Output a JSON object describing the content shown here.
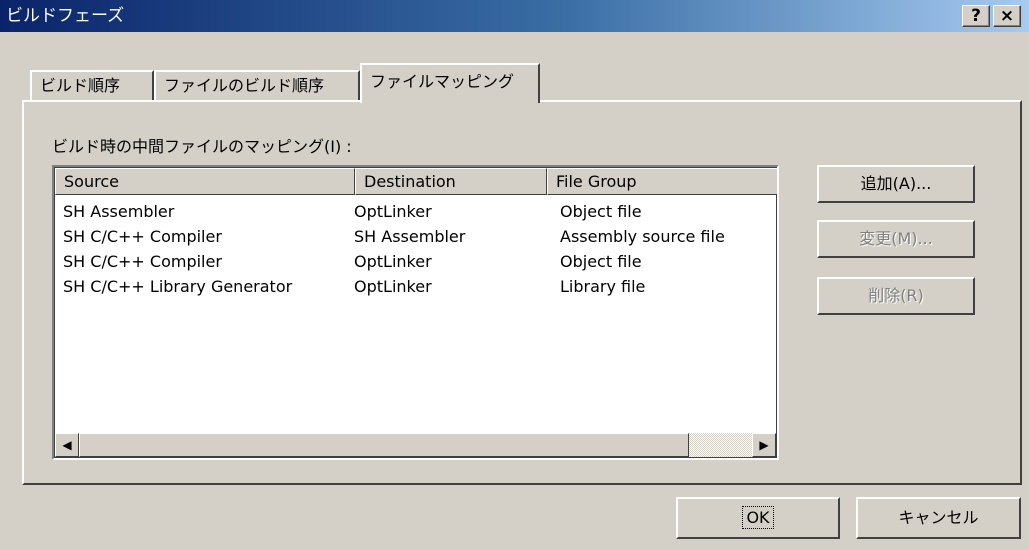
{
  "window": {
    "title": "ビルドフェーズ",
    "help_label": "?",
    "close_label": "×"
  },
  "tabs": [
    {
      "label": "ビルド順序",
      "active": false
    },
    {
      "label": "ファイルのビルド順序",
      "active": false
    },
    {
      "label": "ファイルマッピング",
      "active": true
    }
  ],
  "mapping": {
    "label": "ビルド時の中間ファイルのマッピング(I) :",
    "columns": [
      "Source",
      "Destination",
      "File Group"
    ],
    "rows": [
      {
        "source": "SH Assembler",
        "destination": "OptLinker",
        "file_group": "Object file"
      },
      {
        "source": "SH C/C++ Compiler",
        "destination": "SH Assembler",
        "file_group": "Assembly source file"
      },
      {
        "source": "SH C/C++ Compiler",
        "destination": "OptLinker",
        "file_group": "Object file"
      },
      {
        "source": "SH C/C++ Library Generator",
        "destination": "OptLinker",
        "file_group": "Library file"
      }
    ]
  },
  "buttons": {
    "add": "追加(A)...",
    "edit": "変更(M)...",
    "delete": "削除(R)",
    "ok": "OK",
    "cancel": "キャンセル"
  },
  "icons": {
    "scroll_left": "arrow-left-icon",
    "scroll_right": "arrow-right-icon"
  },
  "colors": {
    "dialog_bg": "#d4d0c8",
    "titlebar_start": "#0a246a",
    "titlebar_end": "#a6caf0",
    "disabled_text": "#808080"
  }
}
